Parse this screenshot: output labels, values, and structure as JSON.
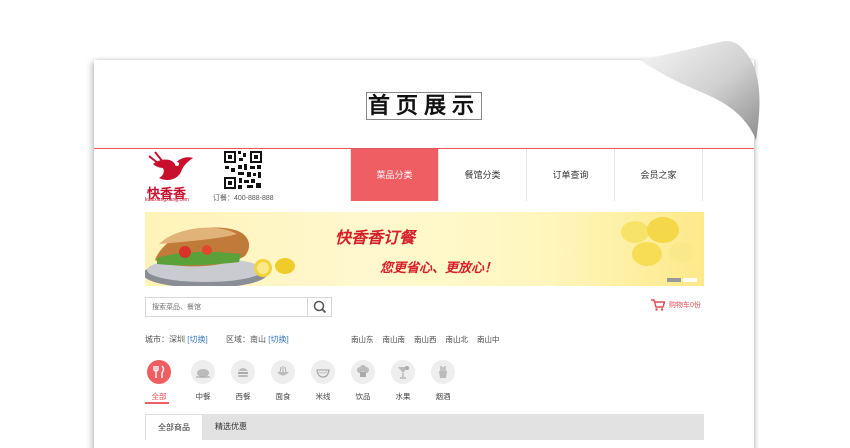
{
  "page_title": "首页展示",
  "header": {
    "logo_text": "快香香",
    "logo_domain": "kuaixiangxiang.com",
    "order_tel": "订餐：400-888-888"
  },
  "nav": [
    {
      "label": "菜品分类",
      "active": true
    },
    {
      "label": "餐馆分类",
      "active": false
    },
    {
      "label": "订单查询",
      "active": false
    },
    {
      "label": "会员之家",
      "active": false
    }
  ],
  "banner": {
    "headline": "快香香订餐",
    "slogan": "您更省心、更放心！"
  },
  "search": {
    "placeholder": "搜索菜品、餐馆"
  },
  "cart": {
    "label": "购物车0份"
  },
  "location": {
    "city_label": "城市：深圳",
    "city_switch": "[切换]",
    "area_label": "区域：南山",
    "area_switch": "[切换]",
    "areas": [
      "南山东",
      "南山南",
      "南山西",
      "南山北",
      "南山中"
    ]
  },
  "categories": [
    {
      "label": "全部",
      "icon": "fork-knife-icon",
      "active": true
    },
    {
      "label": "中餐",
      "icon": "roast-chicken-icon",
      "active": false
    },
    {
      "label": "西餐",
      "icon": "burger-icon",
      "active": false
    },
    {
      "label": "面食",
      "icon": "noodle-bowl-icon",
      "active": false
    },
    {
      "label": "米线",
      "icon": "rice-noodle-bowl-icon",
      "active": false
    },
    {
      "label": "饮品",
      "icon": "chef-hat-icon",
      "active": false
    },
    {
      "label": "水果",
      "icon": "cocktail-icon",
      "active": false
    },
    {
      "label": "烟酒",
      "icon": "fries-icon",
      "active": false
    }
  ],
  "tabs": [
    {
      "label": "全部商品",
      "active": true
    },
    {
      "label": "精选优惠",
      "active": false
    }
  ],
  "colors": {
    "accent": "#ee5e63",
    "brand_red": "#c8102e",
    "link_blue": "#3a7ac4"
  }
}
